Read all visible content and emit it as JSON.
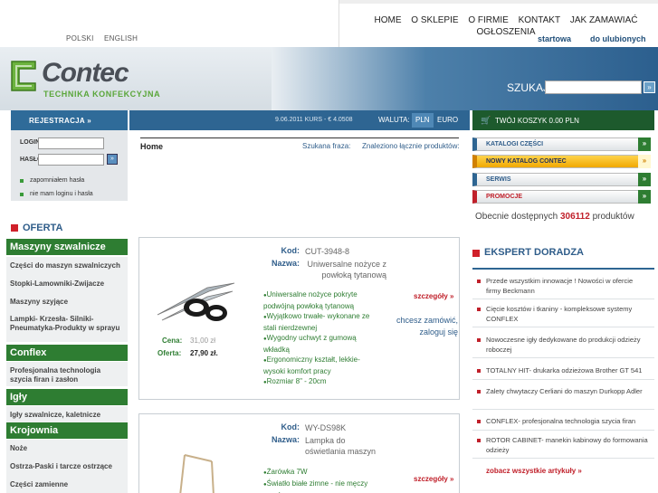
{
  "lang": {
    "pl": "POLSKI",
    "en": "ENGLISH"
  },
  "topnav": {
    "menu": [
      "HOME",
      "O SKLEPIE",
      "O FIRMIE",
      "KONTAKT",
      "JAK ZAMAWIAĆ",
      "OGŁOSZENIA"
    ],
    "startowa": "startowa",
    "ulubione": "do ulubionych"
  },
  "logo": {
    "word": "Contec",
    "tagline": "TECHNIKA KONFEKCYJNA"
  },
  "search": {
    "label": "SZUKAJ",
    "value": ""
  },
  "infobar": {
    "date": "9.06.2011  KURS - € 4.0508",
    "waluta": "WALUTA:",
    "pln": "PLN",
    "euro": "EURO"
  },
  "cart": {
    "text": "TWÓJ KOSZYK 0.00 PLN"
  },
  "login": {
    "title": "REJESTRACJA",
    "login_label": "LOGIN",
    "haslo_label": "HASŁO",
    "forgot": "zapomniałem hasła",
    "nologin": "nie mam loginu i hasła"
  },
  "oferta": "OFERTA",
  "sidebar": [
    {
      "cat": "Maszyny szwalnicze",
      "subs": [
        "Części do maszyn szwalniczych",
        "Stopki-Lamowniki-Zwijacze",
        "Maszyny szyjące",
        "Lampki- Krzesła- Silniki- Pneumatyka-Produkty w sprayu"
      ]
    },
    {
      "cat": "Conflex",
      "subs": [
        "Profesjonalna technologia szycia firan i zasłon"
      ]
    },
    {
      "cat": "Igły",
      "subs": [
        "Igły szwalnicze, kaletnicze"
      ]
    },
    {
      "cat": "Krojownia",
      "subs": [
        "Noże",
        "Ostrza-Paski i tarcze ostrzące",
        "Części zamienne"
      ]
    }
  ],
  "main": {
    "crumb": "Home",
    "szukana": "Szukana fraza:",
    "znaleziono": "Znaleziono łącznie produktów:",
    "products": [
      {
        "kod_label": "Kod:",
        "kod": "CUT-3948-8",
        "nazwa_label": "Nazwa:",
        "nazwa": "Uniwersalne nożyce z powłoką tytanową",
        "features": [
          "Uniwersalne nożyce pokryte podwójną powłoką tytanową",
          "Wyjątkowo trwałe- wykonane ze stali nierdzewnej",
          "Wygodny uchwyt z gumową wkładką",
          "Ergonomiczny kształt, lekkie- wysoki komfort pracy",
          "Rozmiar 8\" - 20cm"
        ],
        "szczegoly": "szczegóły",
        "chcesz": "chcesz zamówić, zaloguj się",
        "cena_label": "Cena:",
        "cena": "31,00 zł",
        "oferta_label": "Oferta:",
        "oferta": "27,90 zł."
      },
      {
        "kod_label": "Kod:",
        "kod": "WY-DS98K",
        "nazwa_label": "Nazwa:",
        "nazwa": "Lampka do oświetlania maszyn",
        "features": [
          "Żarówka 7W",
          "Światło białe zimne - nie męczy wzroku"
        ],
        "szczegoly": "szczegóły"
      }
    ]
  },
  "right": {
    "buttons": [
      "KATALOGI CZĘŚCI",
      "NOWY KATALOG CONTEC",
      "SERWIS",
      "PROMOCJE"
    ],
    "dostep_pre": "Obecnie dostępnych",
    "dostep_num": "306112",
    "dostep_post": "produktów",
    "ekspert": "EKSPERT DORADZA",
    "articles": [
      "Przede wszystkim innowacje ! Nowości w ofercie firmy Beckmann",
      "Cięcie kosztów i tkaniny - kompleksowe systemy CONFLEX",
      "Nowoczesne igły dedykowane do produkcji odzieży roboczej",
      "TOTALNY HIT- drukarka odzieżowa Brother GT 541",
      "Zalety chwytaczy Cerliani do maszyn Durkopp Adler",
      "CONFLEX- profesjonalna technologia szycia firan",
      "ROTOR CABINET- manekin kabinowy do formowania odzieży"
    ],
    "zobacz": "zobacz wszystkie artykuły"
  }
}
